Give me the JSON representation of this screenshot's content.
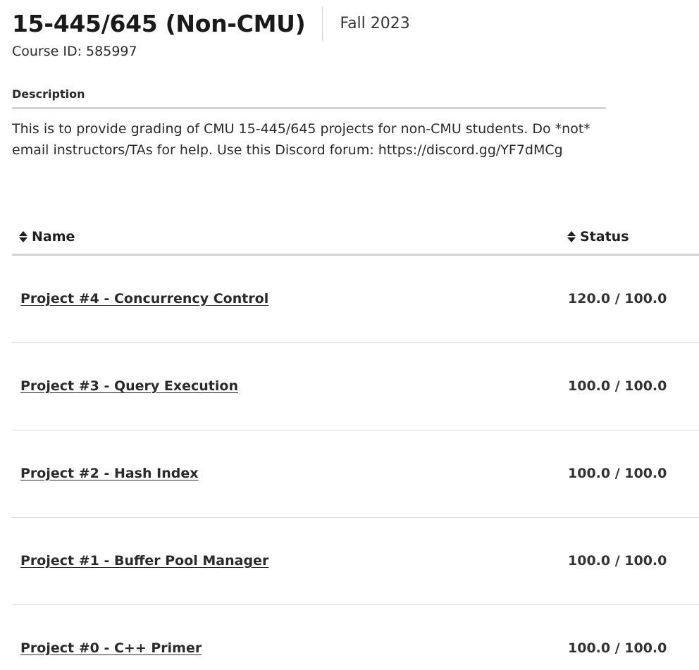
{
  "course": {
    "title": "15-445/645 (Non-CMU)",
    "term": "Fall 2023",
    "id_label": "Course ID: 585997"
  },
  "description": {
    "heading": "Description",
    "text": "This is to provide grading of CMU 15-445/645 projects for non-CMU students. Do *not* email instructors/TAs for help. Use this Discord forum: https://discord.gg/YF7dMCg"
  },
  "table": {
    "columns": {
      "name": "Name",
      "status": "Status"
    },
    "icons": {
      "sort": "sort-icon"
    },
    "rows": [
      {
        "name": "Project #4 - Concurrency Control",
        "status": "120.0 / 100.0"
      },
      {
        "name": "Project #3 - Query Execution",
        "status": "100.0 / 100.0"
      },
      {
        "name": "Project #2 - Hash Index",
        "status": "100.0 / 100.0"
      },
      {
        "name": "Project #1 - Buffer Pool Manager",
        "status": "100.0 / 100.0"
      },
      {
        "name": "Project #0 - C++ Primer",
        "status": "100.0 / 100.0"
      }
    ]
  }
}
